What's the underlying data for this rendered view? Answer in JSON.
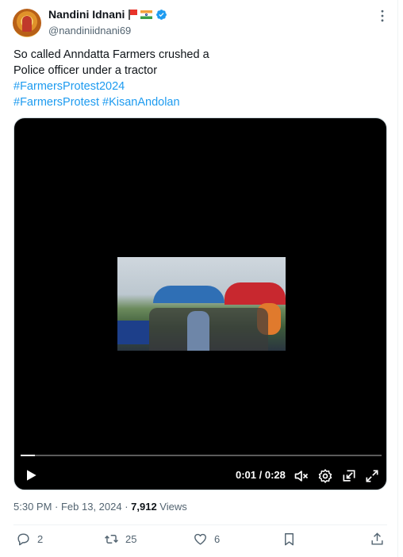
{
  "author": {
    "name": "Nandini Idnani",
    "handle": "@nandiniidnani69",
    "avatar": "avatar-image",
    "badges": [
      "red-flag-emoji",
      "india-flag-emoji",
      "verified-badge"
    ]
  },
  "tweet": {
    "line1": "So called Anndatta Farmers crushed a",
    "line2": "Police officer under a tractor",
    "hashtag1": "#FarmersProtest2024",
    "hashtag2": "#FarmersProtest",
    "hashtag3": "#KisanAndolan"
  },
  "video": {
    "time": "0:01 / 0:28",
    "progress": 0.04
  },
  "meta": {
    "timestamp": "5:30 PM · Feb 13, 2024 · ",
    "views_count": "7,912",
    "views_label": " Views"
  },
  "actions": {
    "replies": "2",
    "reposts": "25",
    "likes": "6"
  },
  "colors": {
    "accent": "#1d9bf0",
    "muted": "#536471"
  }
}
